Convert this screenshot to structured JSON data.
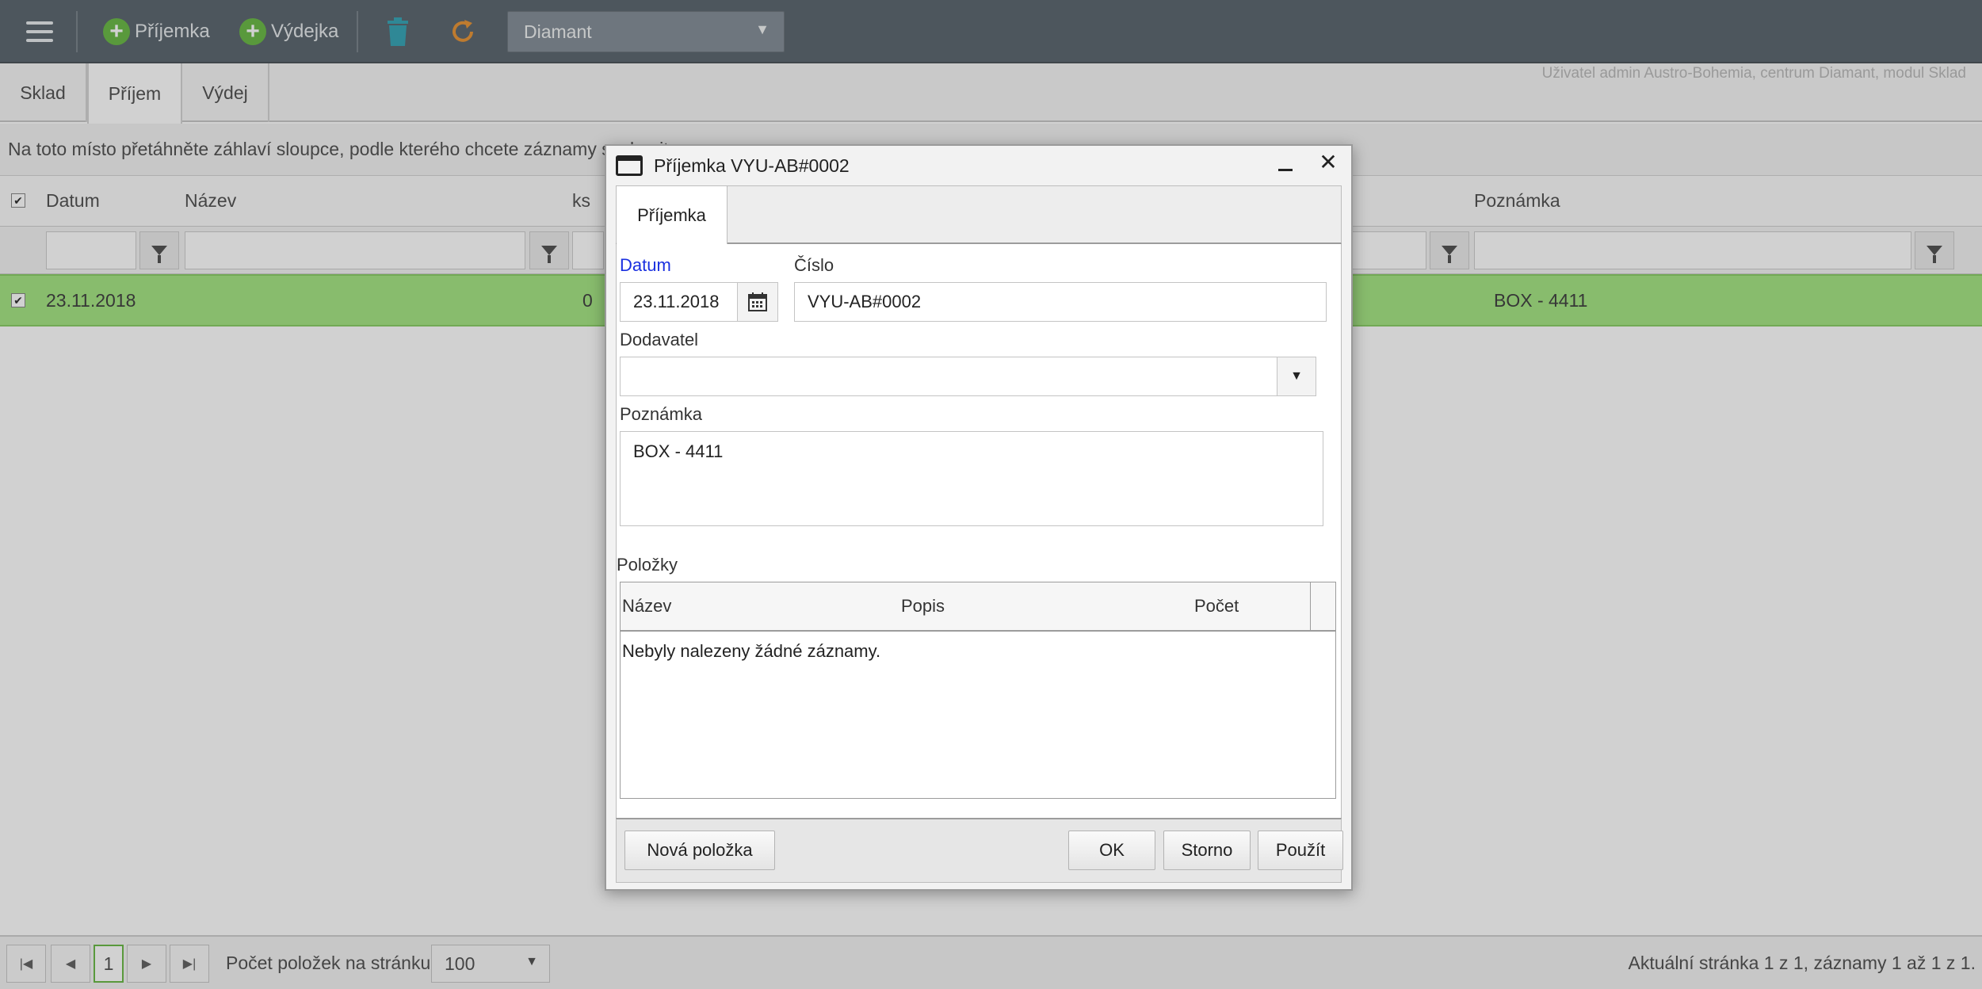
{
  "toolbar": {
    "menu_icon": "hamburger-icon",
    "receipt_label": "Příjemka",
    "issue_label": "Výdejka",
    "delete_icon": "trash-icon",
    "refresh_icon": "refresh-icon",
    "center_value": "Diamant",
    "colors": {
      "bar": "#5f6a72",
      "plus": "#6dbb4a",
      "trash": "#3aa7b8",
      "refresh": "#e8963a"
    }
  },
  "tabs": [
    {
      "label": "Sklad",
      "active": false
    },
    {
      "label": "Příjem",
      "active": true
    },
    {
      "label": "Výdej",
      "active": false
    }
  ],
  "user_info": "Uživatel admin Austro-Bohemia, centrum Diamant, modul Sklad",
  "group_bar_text": "Na toto místo přetáhněte záhlaví sloupce, podle kterého chcete záznamy seskupit",
  "grid": {
    "columns": [
      "Datum",
      "Název",
      "ks",
      "Poznámka"
    ],
    "rows": [
      {
        "datum": "23.11.2018",
        "ks": "0",
        "poznamka": "BOX - 4411",
        "selected": true
      }
    ],
    "selected_color": "#a6e685"
  },
  "pager": {
    "current_page": "1",
    "per_page_label": "Počet položek na stránku:",
    "per_page_value": "100",
    "info": "Aktuální stránka 1 z 1, záznamy 1 až 1 z 1."
  },
  "modal": {
    "title": "Příjemka VYU-AB#0002",
    "tab": "Příjemka",
    "date_label": "Datum",
    "date_value": "23.11.2018",
    "number_label": "Číslo",
    "number_value": "VYU-AB#0002",
    "supplier_label": "Dodavatel",
    "supplier_value": "",
    "note_label": "Poznámka",
    "note_value": "BOX - 4411",
    "items_label": "Položky",
    "items_columns": [
      "Název",
      "Popis",
      "Počet"
    ],
    "items_empty": "Nebyly nalezeny žádné záznamy.",
    "buttons": {
      "new_item": "Nová položka",
      "ok": "OK",
      "cancel": "Storno",
      "apply": "Použít"
    },
    "required_label_color": "#1a30e0"
  }
}
